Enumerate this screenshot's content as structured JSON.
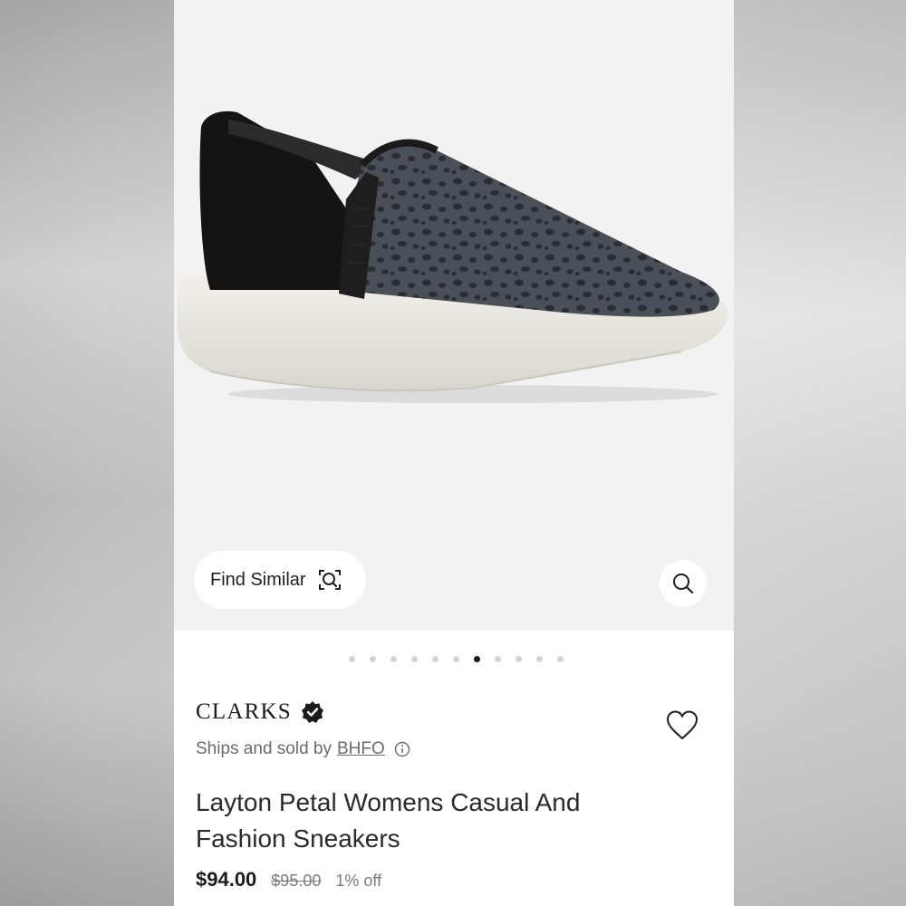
{
  "gallery": {
    "image_alt": "Black leopard print slip-on sneaker with white platform sole",
    "find_similar_label": "Find Similar",
    "dots_count": 11,
    "active_dot_index": 6
  },
  "product": {
    "brand": "CLARKS",
    "ships_prefix": "Ships and sold by",
    "seller": "BHFO",
    "title": "Layton Petal Womens Casual And Fashion Sneakers",
    "price": "$94.00",
    "original_price": "$95.00",
    "discount": "1% off"
  },
  "icons": {
    "find_similar": "image-search-icon",
    "zoom": "magnifier-icon",
    "verified": "verified-badge-icon",
    "favorite": "heart-icon",
    "info": "info-icon"
  },
  "colors": {
    "text_primary": "#1b1b1b",
    "text_secondary": "#6b6b6b",
    "active_dot": "#1a1a1a",
    "inactive_dot": "#d4d4d4"
  }
}
